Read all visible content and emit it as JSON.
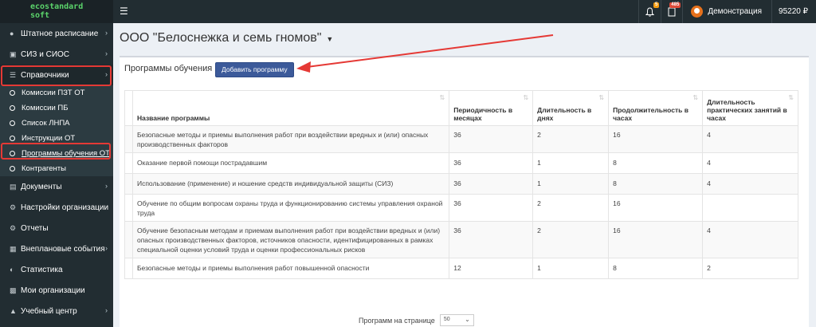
{
  "brand": {
    "line1": "ecostandard",
    "line2": "soft"
  },
  "topbar": {
    "notifications_badge": "5",
    "messages_badge": "485",
    "user_name": "Демонстрация",
    "balance": "95220 ₽"
  },
  "sidebar": {
    "items": [
      {
        "label": "Штатное расписание",
        "icon": "users-icon",
        "has_children": true
      },
      {
        "label": "СИЗ и СИОС",
        "icon": "calendar-check-icon",
        "has_children": true
      },
      {
        "label": "Справочники",
        "icon": "list-icon",
        "has_children": true
      },
      {
        "label": "Документы",
        "icon": "folder-icon",
        "has_children": true
      },
      {
        "label": "Настройки организации",
        "icon": "gear-icon",
        "has_children": false
      },
      {
        "label": "Отчеты",
        "icon": "gear-icon",
        "has_children": false
      },
      {
        "label": "Внеплановые события",
        "icon": "calendar-icon",
        "has_children": true
      },
      {
        "label": "Статистика",
        "icon": "pie-chart-icon",
        "has_children": false
      },
      {
        "label": "Мои организации",
        "icon": "building-icon",
        "has_children": false
      },
      {
        "label": "Учебный центр",
        "icon": "graduation-cap-icon",
        "has_children": true
      }
    ],
    "subitems": [
      {
        "label": "Комиссии ПЗТ ОТ"
      },
      {
        "label": "Комиссии ПБ"
      },
      {
        "label": "Список ЛНПА"
      },
      {
        "label": "Инструкции ОТ"
      },
      {
        "label": "Программы обучения ОТ"
      },
      {
        "label": "Контрагенты"
      }
    ]
  },
  "page": {
    "title": "ООО \"Белоснежка и семь гномов\"",
    "box_title": "Программы обучения",
    "add_button": "Добавить программу"
  },
  "table": {
    "headers": [
      "Название программы",
      "Периодичность в месяцах",
      "Длительность в днях",
      "Продолжительность в часах",
      "Длительность практических занятий в часах"
    ],
    "rows": [
      {
        "name": "Безопасные методы и приемы выполнения работ при воздействии вредных и (или) опасных производственных факторов",
        "period": "36",
        "days": "2",
        "hours": "16",
        "practice": "4"
      },
      {
        "name": "Оказание первой помощи пострадавшим",
        "period": "36",
        "days": "1",
        "hours": "8",
        "practice": "4"
      },
      {
        "name": "Использование (применение) и ношение средств индивидуальной защиты (СИЗ)",
        "period": "36",
        "days": "1",
        "hours": "8",
        "practice": "4"
      },
      {
        "name": "Обучение по общим вопросам охраны труда и функционированию системы управления охраной труда",
        "period": "36",
        "days": "2",
        "hours": "16",
        "practice": ""
      },
      {
        "name": "Обучение безопасным методам и приемам выполнения работ при воздействии вредных и (или) опасных производственных факторов, источников опасности, идентифицированных в рамках специальной оценки условий труда и оценки профессиональных рисков",
        "period": "36",
        "days": "2",
        "hours": "16",
        "practice": "4"
      },
      {
        "name": "Безопасные методы и приемы выполнения работ повышенной опасности",
        "period": "12",
        "days": "1",
        "hours": "8",
        "practice": "2"
      }
    ]
  },
  "pager": {
    "label": "Программ на странице",
    "value": "50"
  },
  "colors": {
    "sidebar_bg": "#222d32",
    "button_bg": "#3c5a9a",
    "highlight": "#e53935",
    "brand": "#5bd46b"
  }
}
